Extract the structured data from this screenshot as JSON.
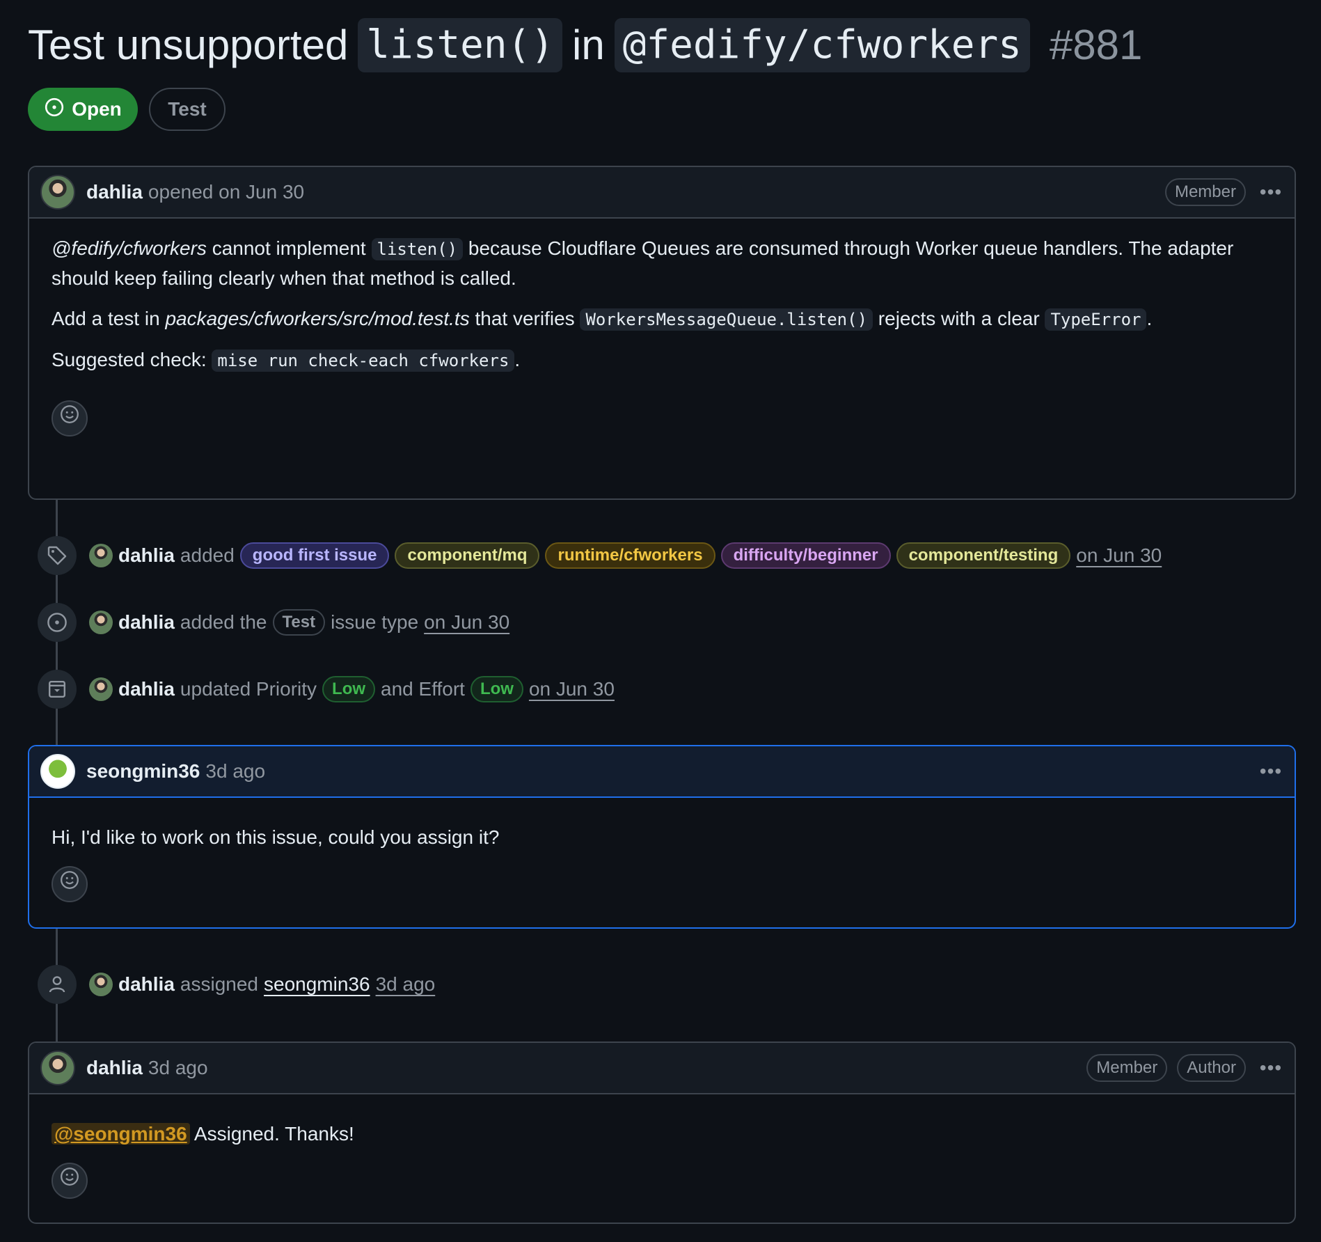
{
  "issue": {
    "title_prefix": "Test unsupported",
    "title_code1": "listen()",
    "title_mid": "in",
    "title_code2": "@fedify/cfworkers",
    "number": "#881",
    "state": "Open",
    "type": "Test"
  },
  "opening_comment": {
    "author": "dahlia",
    "action": "opened on Jun 30",
    "role": "Member",
    "para1_em": "@fedify/cfworkers",
    "para1_a": " cannot implement ",
    "para1_code": "listen()",
    "para1_b": " because Cloudflare Queues are consumed through Worker queue handlers. The adapter should keep failing clearly when that method is called.",
    "para2_a": "Add a test in ",
    "para2_em": "packages/cfworkers/src/mod.test.ts",
    "para2_b": " that verifies ",
    "para2_code1": "WorkersMessageQueue.listen()",
    "para2_c": " rejects with a clear ",
    "para2_code2": "TypeError",
    "para2_d": ".",
    "para3_a": "Suggested check: ",
    "para3_code": "mise run check-each cfworkers",
    "para3_b": "."
  },
  "timeline": {
    "labels_event": {
      "actor": "dahlia",
      "verb": "added",
      "labels": [
        {
          "name": "good first issue",
          "fg": "#b9b6ff",
          "bg": "#272655",
          "border": "#4b4a9a"
        },
        {
          "name": "component/mq",
          "fg": "#e4e89a",
          "bg": "#2f3118",
          "border": "#5a5d2c"
        },
        {
          "name": "runtime/cfworkers",
          "fg": "#f2c744",
          "bg": "#3a2f0c",
          "border": "#6b5714"
        },
        {
          "name": "difficulty/beginner",
          "fg": "#d9a6f2",
          "bg": "#34203f",
          "border": "#5d3a70"
        },
        {
          "name": "component/testing",
          "fg": "#e4e89a",
          "bg": "#2f3118",
          "border": "#5a5d2c"
        }
      ],
      "when": "on Jun 30"
    },
    "type_event": {
      "actor": "dahlia",
      "verb": "added the",
      "type": "Test",
      "suffix": "issue type",
      "when": "on Jun 30"
    },
    "priority_event": {
      "actor": "dahlia",
      "verb": "updated Priority",
      "priority": "Low",
      "mid": "and Effort",
      "effort": "Low",
      "when": "on Jun 30"
    },
    "assign_event": {
      "actor": "dahlia",
      "verb": "assigned",
      "assignee": "seongmin36",
      "when": "3d ago"
    }
  },
  "comment2": {
    "author": "seongmin36",
    "when": "3d ago",
    "body": "Hi, I'd like to work on this issue, could you assign it?"
  },
  "comment3": {
    "author": "dahlia",
    "when": "3d ago",
    "role1": "Member",
    "role2": "Author",
    "mention": "@seongmin36",
    "body": " Assigned. Thanks!"
  },
  "colors": {
    "open_green": "#238636",
    "low_pill_fg": "#3fb950",
    "low_pill_bg": "#12261b",
    "blue_border": "#1f6feb"
  },
  "icons": [
    "issue-open-icon",
    "tag-icon",
    "issue-type-icon",
    "project-field-icon",
    "person-icon",
    "smiley-icon",
    "kebab-icon"
  ]
}
